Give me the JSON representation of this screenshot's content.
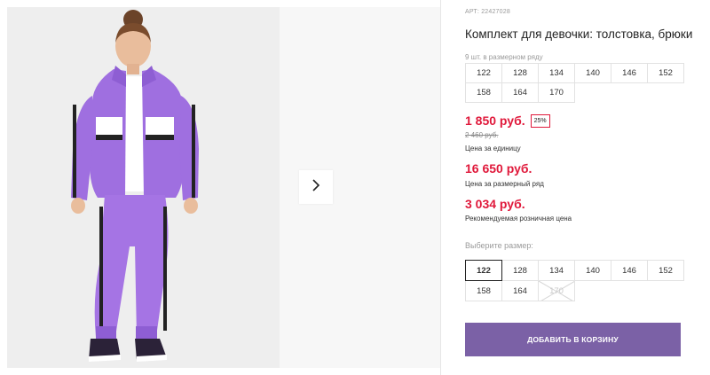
{
  "product": {
    "article_label": "АРТ: 22427028",
    "title": "Комплект для девочки: толстовка, брюки",
    "pack_note": "9 шт. в размерном ряду"
  },
  "size_row": [
    "122",
    "128",
    "134",
    "140",
    "146",
    "152",
    "158",
    "164",
    "170"
  ],
  "prices": {
    "unit_price": "1 850 руб.",
    "discount": "25%",
    "old_price": "2 460 руб.",
    "unit_note": "Цена за единицу",
    "series_price": "16 650 руб.",
    "series_note": "Цена за размерный ряд",
    "retail_price": "3 034 руб.",
    "retail_note": "Рекомендуемая розничная цена"
  },
  "size_select": {
    "label": "Выберите размер:",
    "options": [
      "122",
      "128",
      "134",
      "140",
      "146",
      "152",
      "158",
      "164",
      "170"
    ],
    "selected": "122",
    "unavailable": [
      "170"
    ]
  },
  "cart_button": "ДОБАВИТЬ В КОРЗИНУ",
  "colors": {
    "accent_purple": "#7b61a6",
    "price_red": "#e0193b"
  },
  "icons": {
    "next": "chevron-right-icon"
  }
}
